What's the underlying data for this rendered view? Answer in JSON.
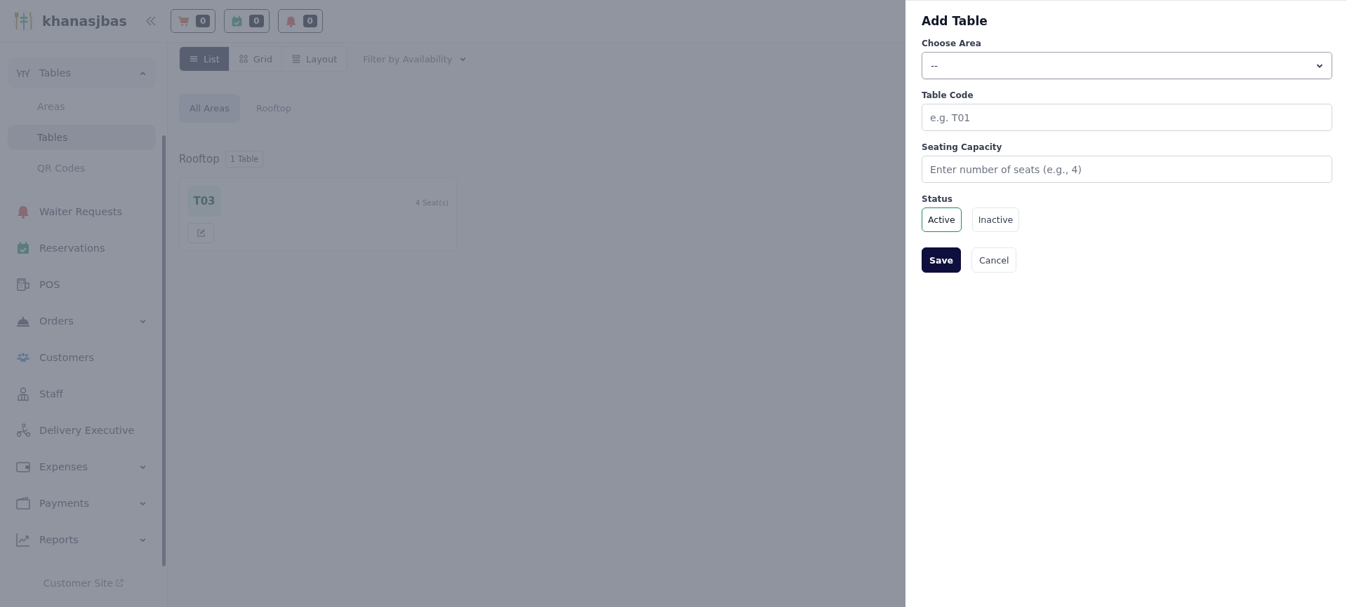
{
  "header": {
    "brand": "khanasjbas",
    "badges": [
      {
        "kind": "cart",
        "count": "0"
      },
      {
        "kind": "calendar",
        "count": "0"
      },
      {
        "kind": "bell",
        "count": "0"
      }
    ]
  },
  "sidebar": {
    "items": [
      {
        "kind": "tables",
        "label": "Tables",
        "expanded": true,
        "children": [
          {
            "label": "Areas",
            "selected": false
          },
          {
            "label": "Tables",
            "selected": true
          },
          {
            "label": "QR Codes",
            "selected": false
          }
        ]
      },
      {
        "kind": "bell",
        "label": "Waiter Requests"
      },
      {
        "kind": "calendar",
        "label": "Reservations"
      },
      {
        "kind": "pos",
        "label": "POS"
      },
      {
        "kind": "cloche",
        "label": "Orders",
        "expanded": false
      },
      {
        "kind": "people",
        "label": "Customers"
      },
      {
        "kind": "person",
        "label": "Staff"
      },
      {
        "kind": "scooter",
        "label": "Delivery Executive"
      },
      {
        "kind": "wallet",
        "label": "Expenses",
        "expanded": false
      },
      {
        "kind": "card",
        "label": "Payments",
        "expanded": false
      },
      {
        "kind": "chart",
        "label": "Reports",
        "expanded": false
      }
    ],
    "footer_link": "Customer Site"
  },
  "content": {
    "views": [
      {
        "kind": "list",
        "label": "List",
        "selected": true
      },
      {
        "kind": "grid",
        "label": "Grid",
        "selected": false
      },
      {
        "kind": "layout",
        "label": "Layout",
        "selected": false
      }
    ],
    "filter": "Filter by Availability",
    "area_tabs": [
      {
        "label": "All Areas",
        "selected": true
      },
      {
        "label": "Rooftop",
        "selected": false
      }
    ],
    "groups": [
      {
        "title": "Rooftop",
        "count": "1 Table",
        "tables": [
          {
            "code": "T03",
            "seats": "4 Seat(s)"
          }
        ]
      }
    ]
  },
  "drawer": {
    "title": "Add Table",
    "fields": [
      {
        "kind": "select",
        "label": "Choose Area",
        "value": "--"
      },
      {
        "kind": "input",
        "label": "Table Code",
        "placeholder": "e.g. T01"
      },
      {
        "kind": "input",
        "label": "Seating Capacity",
        "placeholder": "Enter number of seats (e.g., 4)"
      }
    ],
    "status_label": "Status",
    "status_options": [
      {
        "label": "Active",
        "selected": true
      },
      {
        "label": "Inactive",
        "selected": false
      }
    ],
    "buttons": [
      {
        "kind": "primary",
        "label": "Save"
      },
      {
        "kind": "secondary",
        "label": "Cancel"
      }
    ]
  }
}
